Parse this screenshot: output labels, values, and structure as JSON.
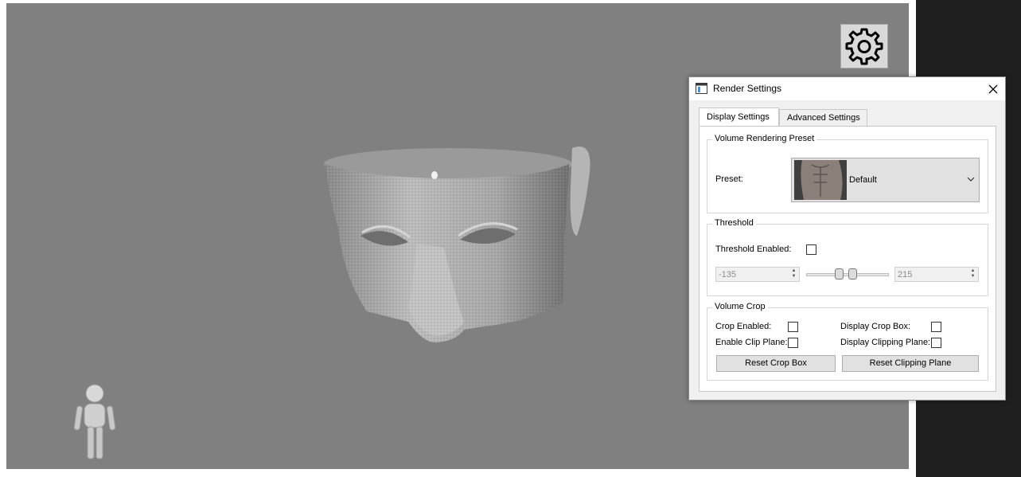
{
  "viewport": {
    "background_color": "#808080",
    "head_render": "3d-volume-rendered-head",
    "orientation_marker": "orientation-human-figure"
  },
  "settings_button": {
    "icon": "gear-icon"
  },
  "dialog": {
    "title": "Render Settings",
    "title_icon": "window-icon",
    "close_icon": "close-icon",
    "tabs": [
      {
        "label": "Display Settings",
        "active": true
      },
      {
        "label": "Advanced Settings",
        "active": false
      }
    ],
    "volume_rendering_preset": {
      "group_title": "Volume Rendering Preset",
      "preset_label": "Preset:",
      "preset_value": "Default",
      "preset_thumbnail": "torso-preset-thumbnail"
    },
    "threshold": {
      "group_title": "Threshold",
      "enabled_label": "Threshold Enabled:",
      "enabled": false,
      "min_value": "-135",
      "max_value": "215"
    },
    "volume_crop": {
      "group_title": "Volume Crop",
      "crop_enabled_label": "Crop Enabled:",
      "display_crop_box_label": "Display Crop Box:",
      "enable_clip_plane_label": "Enable Clip Plane:",
      "display_clipping_plane_label": "Display Clipping Plane:",
      "reset_crop_box_label": "Reset Crop Box",
      "reset_clipping_plane_label": "Reset Clipping Plane"
    }
  }
}
